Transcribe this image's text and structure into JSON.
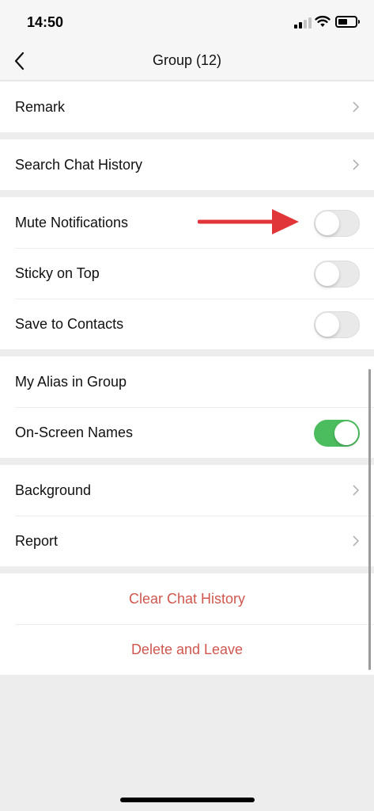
{
  "status": {
    "time": "14:50"
  },
  "nav": {
    "title": "Group (12)"
  },
  "sections": {
    "remark": {
      "label": "Remark"
    },
    "search": {
      "label": "Search Chat History"
    },
    "toggles": [
      {
        "label": "Mute Notifications",
        "on": false
      },
      {
        "label": "Sticky on Top",
        "on": false
      },
      {
        "label": "Save to Contacts",
        "on": false
      }
    ],
    "alias": {
      "label": "My Alias in Group"
    },
    "names": {
      "label": "On-Screen Names",
      "on": true
    },
    "background": {
      "label": "Background"
    },
    "report": {
      "label": "Report"
    },
    "clear": {
      "label": "Clear Chat History"
    },
    "delete": {
      "label": "Delete and Leave"
    }
  },
  "colors": {
    "accent_green": "#4cbd5e",
    "danger": "#d0574f",
    "annotation_arrow": "#e0363a"
  }
}
